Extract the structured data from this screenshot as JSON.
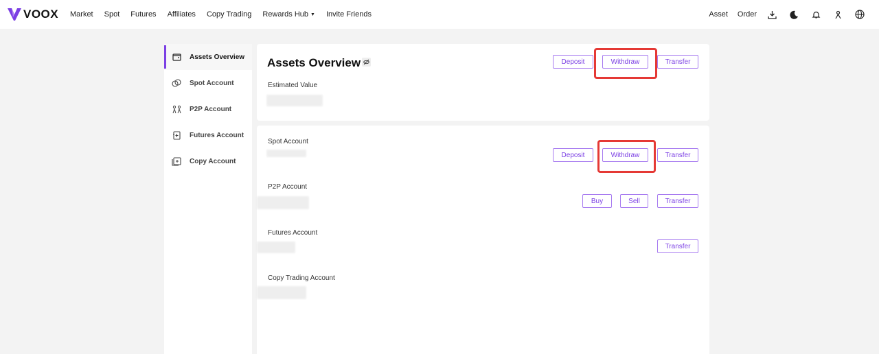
{
  "brand": {
    "name": "VOOX",
    "accent": "#7b3fe4"
  },
  "nav": {
    "links": [
      "Market",
      "Spot",
      "Futures",
      "Affiliates",
      "Copy Trading",
      "Rewards Hub",
      "Invite Friends"
    ],
    "right": {
      "asset": "Asset",
      "order": "Order"
    },
    "icons": [
      "download-icon",
      "moon-icon",
      "bell-icon",
      "user-icon",
      "globe-icon"
    ]
  },
  "sidebar": {
    "items": [
      {
        "label": "Assets Overview",
        "icon": "wallet-icon",
        "active": true
      },
      {
        "label": "Spot Account",
        "icon": "coins-icon",
        "active": false
      },
      {
        "label": "P2P Account",
        "icon": "p2p-icon",
        "active": false
      },
      {
        "label": "Futures Account",
        "icon": "futures-icon",
        "active": false
      },
      {
        "label": "Copy Account",
        "icon": "copy-cards-icon",
        "active": false
      }
    ]
  },
  "overview": {
    "title": "Assets Overview",
    "estimated_label": "Estimated Value",
    "buttons": {
      "deposit": "Deposit",
      "withdraw": "Withdraw",
      "transfer": "Transfer"
    }
  },
  "accounts": {
    "spot": {
      "label": "Spot Account",
      "deposit": "Deposit",
      "withdraw": "Withdraw",
      "transfer": "Transfer"
    },
    "p2p": {
      "label": "P2P Account",
      "buy": "Buy",
      "sell": "Sell",
      "transfer": "Transfer"
    },
    "futures": {
      "label": "Futures Account",
      "transfer": "Transfer"
    },
    "copy": {
      "label": "Copy Trading Account"
    }
  }
}
